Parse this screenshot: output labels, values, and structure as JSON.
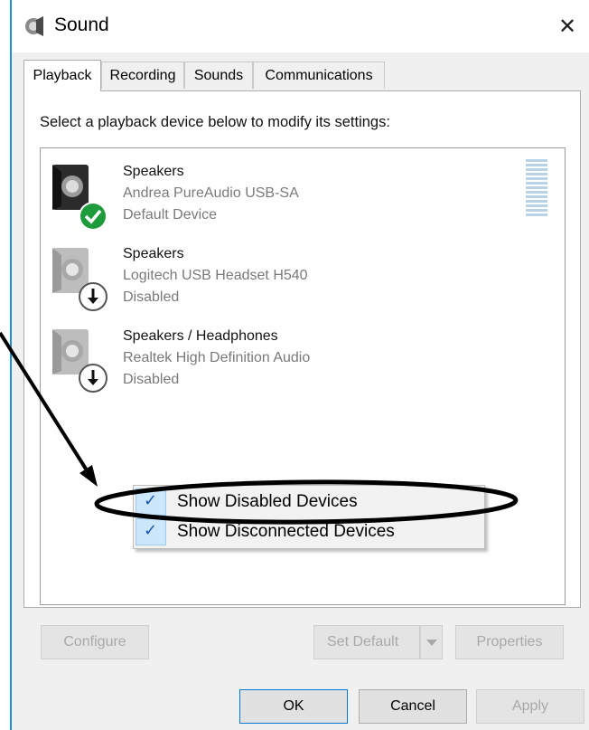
{
  "window": {
    "title": "Sound",
    "close_glyph": "✕",
    "title_icon": "speaker-icon"
  },
  "tabs": [
    {
      "label": "Playback",
      "active": true
    },
    {
      "label": "Recording",
      "active": false
    },
    {
      "label": "Sounds",
      "active": false
    },
    {
      "label": "Communications",
      "active": false
    }
  ],
  "instruction": "Select a playback device below to modify its settings:",
  "devices": [
    {
      "name": "Speakers",
      "description": "Andrea PureAudio USB-SA",
      "status": "Default Device",
      "badge": "green-check-icon"
    },
    {
      "name": "Speakers",
      "description": "Logitech USB Headset H540",
      "status": "Disabled",
      "badge": "down-arrow-icon"
    },
    {
      "name": "Speakers / Headphones",
      "description": "Realtek High Definition Audio",
      "status": "Disabled",
      "badge": "down-arrow-icon"
    }
  ],
  "context_menu": {
    "items": [
      {
        "label": "Show Disabled Devices",
        "checked": true
      },
      {
        "label": "Show Disconnected Devices",
        "checked": true
      }
    ]
  },
  "buttons": {
    "configure": "Configure",
    "set_default": "Set Default",
    "properties": "Properties",
    "ok": "OK",
    "cancel": "Cancel",
    "apply": "Apply"
  },
  "colors": {
    "accent": "#0078d7",
    "window_border": "#1e90d8",
    "annotation": "#000000",
    "default_check": "#1e9b3a"
  }
}
